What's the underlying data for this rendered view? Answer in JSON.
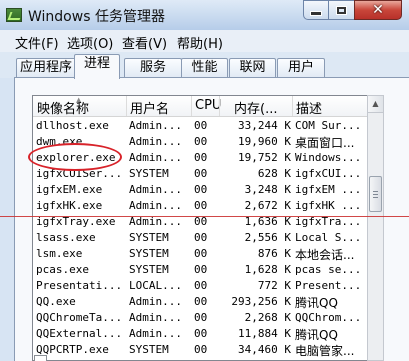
{
  "window": {
    "title": "Windows 任务管理器",
    "minimize_glyph": "—",
    "maximize_glyph": "□",
    "close_glyph": "✕"
  },
  "menu": [
    "文件(F)",
    "选项(O)",
    "查看(V)",
    "帮助(H)"
  ],
  "tabs": [
    {
      "label": "应用程序",
      "active": false
    },
    {
      "label": "进程",
      "active": true
    },
    {
      "label": "服务",
      "active": false
    },
    {
      "label": "性能",
      "active": false
    },
    {
      "label": "联网",
      "active": false
    },
    {
      "label": "用户",
      "active": false
    }
  ],
  "columns": {
    "name": "映像名称",
    "user": "用户名",
    "cpu": "CPU",
    "mem": "内存(...",
    "desc": "描述"
  },
  "rows": [
    {
      "name": "dllhost.exe",
      "user": "Admin...",
      "cpu": "00",
      "mem": "33,244 K",
      "desc": "COM Sur..."
    },
    {
      "name": "dwm.exe",
      "user": "Admin...",
      "cpu": "00",
      "mem": "19,960 K",
      "desc": "桌面窗口..."
    },
    {
      "name": "explorer.exe",
      "user": "Admin...",
      "cpu": "00",
      "mem": "19,752 K",
      "desc": "Windows..."
    },
    {
      "name": "igfxCUISer...",
      "user": "SYSTEM",
      "cpu": "00",
      "mem": "628 K",
      "desc": "igfxCUI..."
    },
    {
      "name": "igfxEM.exe",
      "user": "Admin...",
      "cpu": "00",
      "mem": "3,248 K",
      "desc": "igfxEM ..."
    },
    {
      "name": "igfxHK.exe",
      "user": "Admin...",
      "cpu": "00",
      "mem": "2,672 K",
      "desc": "igfxHK ..."
    },
    {
      "name": "igfxTray.exe",
      "user": "Admin...",
      "cpu": "00",
      "mem": "1,636 K",
      "desc": "igfxTra..."
    },
    {
      "name": "lsass.exe",
      "user": "SYSTEM",
      "cpu": "00",
      "mem": "2,556 K",
      "desc": "Local S..."
    },
    {
      "name": "lsm.exe",
      "user": "SYSTEM",
      "cpu": "00",
      "mem": "876 K",
      "desc": "本地会话..."
    },
    {
      "name": "pcas.exe",
      "user": "SYSTEM",
      "cpu": "00",
      "mem": "1,628 K",
      "desc": "pcas se..."
    },
    {
      "name": "Presentati...",
      "user": "LOCAL...",
      "cpu": "00",
      "mem": "772 K",
      "desc": "Present..."
    },
    {
      "name": "QQ.exe",
      "user": "Admin...",
      "cpu": "00",
      "mem": "293,256 K",
      "desc": "腾讯QQ"
    },
    {
      "name": "QQChromeTa...",
      "user": "Admin...",
      "cpu": "00",
      "mem": "2,268 K",
      "desc": "QQChrom..."
    },
    {
      "name": "QQExternal...",
      "user": "Admin...",
      "cpu": "00",
      "mem": "11,884 K",
      "desc": "腾讯QQ"
    },
    {
      "name": "QQPCRTP.exe",
      "user": "SYSTEM",
      "cpu": "00",
      "mem": "34,460 K",
      "desc": "电脑管家..."
    }
  ],
  "scroll": {
    "up_glyph": "▲",
    "sort_glyph": "▲"
  }
}
